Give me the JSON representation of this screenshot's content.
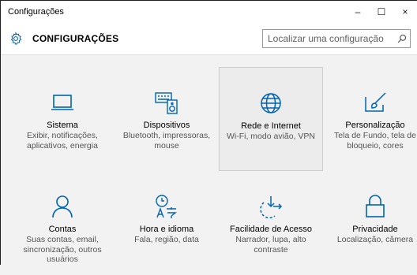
{
  "window": {
    "title": "Configurações",
    "minimize": "–",
    "maximize": "☐",
    "close": "×"
  },
  "header": {
    "title": "CONFIGURAÇÕES",
    "icon": "gear-icon"
  },
  "search": {
    "placeholder": "Localizar uma configuração",
    "icon": "search-icon"
  },
  "accent_color": "#0063b1",
  "tiles": [
    {
      "name": "Sistema",
      "desc": "Exibir, notificações, aplicativos, energia",
      "icon": "laptop-icon"
    },
    {
      "name": "Dispositivos",
      "desc": "Bluetooth, impressoras, mouse",
      "icon": "keyboard-speaker-icon"
    },
    {
      "name": "Rede e Internet",
      "desc": "Wi-Fi, modo avião, VPN",
      "icon": "globe-icon"
    },
    {
      "name": "Personalização",
      "desc": "Tela de Fundo, tela de bloqueio, cores",
      "icon": "paint-brush-icon"
    },
    {
      "name": "Contas",
      "desc": "Suas contas, email, sincronização, outros usuários",
      "icon": "person-icon"
    },
    {
      "name": "Hora e idioma",
      "desc": "Fala, região, data",
      "icon": "time-language-icon"
    },
    {
      "name": "Facilidade de Acesso",
      "desc": "Narrador, lupa, alto contraste",
      "icon": "ease-of-access-icon"
    },
    {
      "name": "Privacidade",
      "desc": "Localização, câmera",
      "icon": "lock-icon"
    }
  ]
}
